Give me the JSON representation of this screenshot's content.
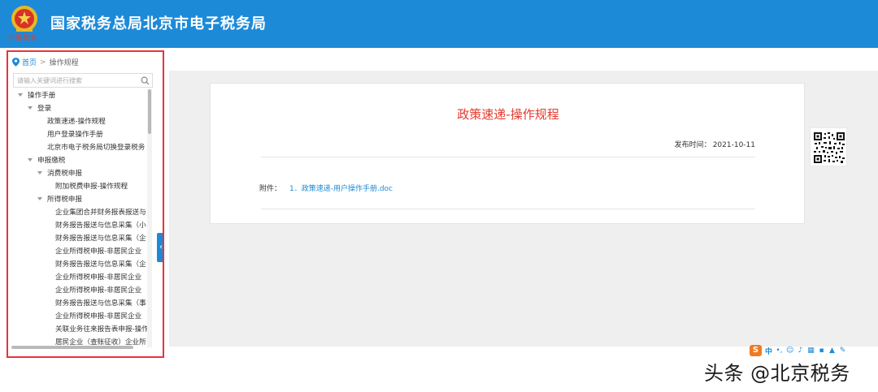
{
  "header": {
    "title": "国家税务总局北京市电子税务局",
    "emblem_caption": "中国税务",
    "color": "#1d8ad8"
  },
  "sidebar": {
    "breadcrumb": {
      "home": "首页",
      "separator": ">",
      "current": "操作规程"
    },
    "search": {
      "placeholder": "请输入关键词进行搜索"
    },
    "tree": [
      {
        "label": "操作手册",
        "expanded": true
      },
      {
        "label": "登录",
        "expanded": true
      },
      {
        "label": "政策速递-操作规程"
      },
      {
        "label": "用户登录操作手册"
      },
      {
        "label": "北京市电子税务局切换登录税务"
      },
      {
        "label": "申报缴税",
        "expanded": true
      },
      {
        "label": "消费税申报",
        "expanded": true
      },
      {
        "label": "附加税费申报-操作规程"
      },
      {
        "label": "所得税申报",
        "expanded": true
      },
      {
        "label": "企业集团合并财务报表报送与"
      },
      {
        "label": "财务报告报送与信息采集（小"
      },
      {
        "label": "财务报告报送与信息采集（企"
      },
      {
        "label": "企业所得税申报-非居民企业"
      },
      {
        "label": "财务报告报送与信息采集（企"
      },
      {
        "label": "企业所得税申报-非居民企业"
      },
      {
        "label": "企业所得税申报-非居民企业"
      },
      {
        "label": "财务报告报送与信息采集（事"
      },
      {
        "label": "企业所得税申报-非居民企业"
      },
      {
        "label": "关联业务往来报告表申报-操作"
      },
      {
        "label": "居民企业（查账征收）企业所"
      }
    ],
    "collapse_icon": "chevron-left-icon"
  },
  "document": {
    "title": "政策速递-操作规程",
    "publish_label": "发布时间：",
    "publish_date": "2021-10-11",
    "attachment_label": "附件：",
    "attachment_link": "1．政策速递-用户操作手册.doc",
    "title_color": "#e5392d"
  },
  "ime": {
    "logo": "S",
    "lang": "中",
    "icons": [
      "punctuation-icon",
      "emoji-icon",
      "microphone-icon",
      "keyboard-icon",
      "toolbox-icon",
      "skin-icon",
      "settings-icon"
    ]
  },
  "watermark": "头条 @北京税务"
}
